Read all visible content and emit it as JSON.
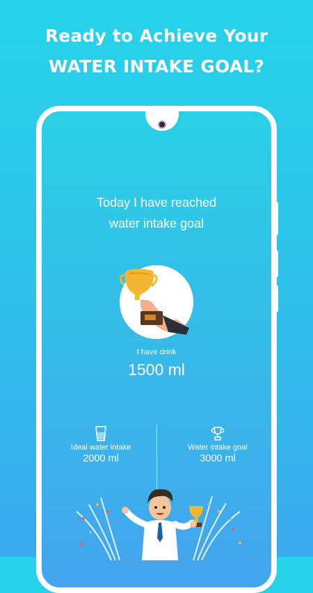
{
  "headline": {
    "line1": "Ready to Achieve Your",
    "line2": "WATER INTAKE GOAL?"
  },
  "screen": {
    "reached_line1": "Today I have reached",
    "reached_line2": "water intake goal",
    "trophy_icon": "trophy-in-hand-icon",
    "drink_label": "I have drink",
    "drink_value": "1500 ml",
    "ideal": {
      "icon": "water-glass-icon",
      "label": "Ideal water intake",
      "value": "2000 ml"
    },
    "goal": {
      "icon": "trophy-icon",
      "label": "Water intake goal",
      "value": "3000 ml"
    },
    "illustration": "celebrating-person-with-trophy"
  },
  "colors": {
    "background_top": "#26d3ea",
    "background_bottom": "#3aa9ee",
    "trophy_gold": "#f2b632"
  }
}
